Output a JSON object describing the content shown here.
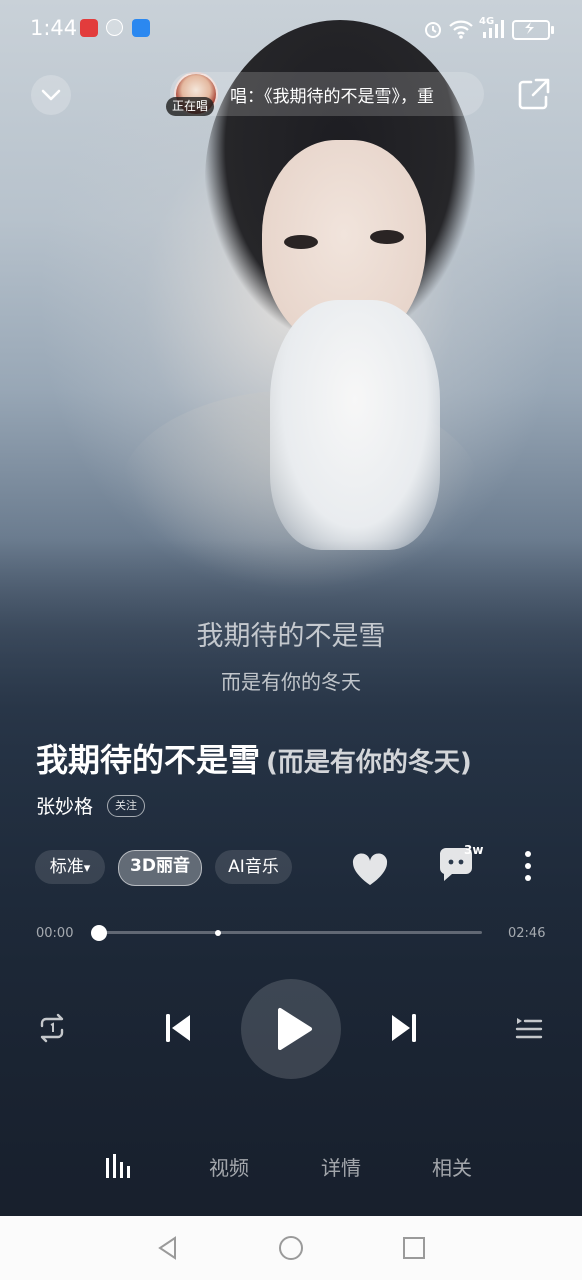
{
  "status_bar": {
    "time": "1:44",
    "network": "4G"
  },
  "header": {
    "now_singing_tag": "正在唱",
    "now_text": "唱：《我期待的不是雪》，重"
  },
  "lyrics": {
    "current_line": "我期待的不是雪",
    "next_line": "而是有你的冬天"
  },
  "song": {
    "title": "我期待的不是雪",
    "subtitle": "(而是有你的冬天)",
    "artist": "张妙格",
    "follow_label": "关注"
  },
  "chips": {
    "quality": "标准",
    "quality_arrow": "▾",
    "sound_3d": "3D丽音",
    "ai_music": "AI音乐"
  },
  "comments": {
    "count": "3w"
  },
  "progress": {
    "current": "00:00",
    "total": "02:46",
    "fraction": 0.0
  },
  "bottom_tabs": {
    "video": "视频",
    "details": "详情",
    "related": "相关"
  },
  "colors": {
    "background_top": "#c9d1d8",
    "background_bottom": "#151d2a",
    "navbar": "#fbfbfb"
  }
}
